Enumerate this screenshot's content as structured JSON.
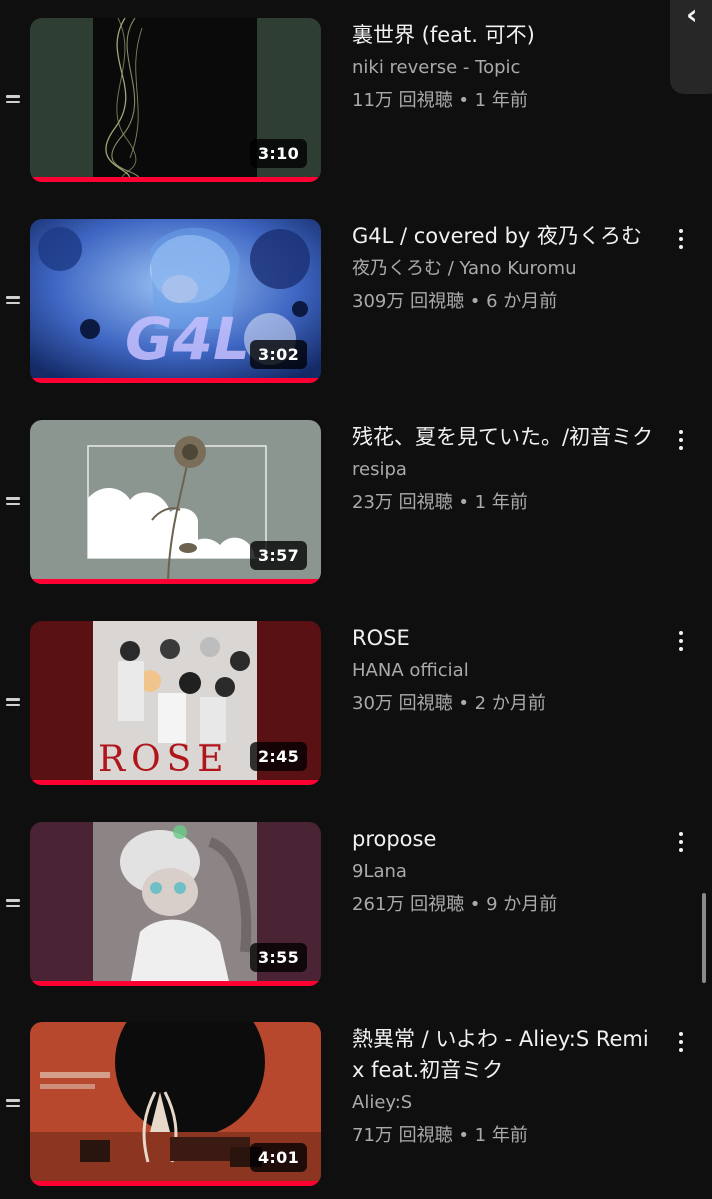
{
  "colors": {
    "background": "#0f0f0f",
    "progress": "#ff0033",
    "secondary_text": "#aaaaaa"
  },
  "playlist": {
    "items": [
      {
        "title": "裏世界 (feat. 可不)",
        "channel": "niki reverse - Topic",
        "meta": "11万 回視聴 • 1 年前",
        "duration": "3:10",
        "watched": 1.0,
        "thumb_colors": {
          "bg": "#2f3e33",
          "art": "#0a0a0a",
          "accent": "#b8c48a"
        },
        "has_menu": false
      },
      {
        "title": "G4L / covered by 夜乃くろむ",
        "channel": "夜乃くろむ / Yano Kuromu",
        "meta": "309万 回視聴 • 6 か月前",
        "duration": "3:02",
        "watched": 1.0,
        "thumb_colors": {
          "bg": "#2b4f9c",
          "art": "#8fb5ef",
          "accent": "#c6c0ff"
        },
        "has_menu": true
      },
      {
        "title": "残花、夏を見ていた。/初音ミク",
        "channel": "resipa",
        "meta": "23万 回視聴 • 1 年前",
        "duration": "3:57",
        "watched": 1.0,
        "thumb_colors": {
          "bg": "#8b9691",
          "art": "#ffffff",
          "accent": "#7a6e58"
        },
        "has_menu": true
      },
      {
        "title": "ROSE",
        "channel": "HANA official",
        "meta": "30万 回視聴 • 2 か月前",
        "duration": "2:45",
        "watched": 1.0,
        "thumb_colors": {
          "bg": "#5a1114",
          "art": "#d9d6d3",
          "accent": "#b0151c"
        },
        "has_menu": true
      },
      {
        "title": "propose",
        "channel": "9Lana",
        "meta": "261万 回視聴 • 9 か月前",
        "duration": "3:55",
        "watched": 1.0,
        "thumb_colors": {
          "bg": "#4a2335",
          "art": "#8d8486",
          "accent": "#cfcfcf"
        },
        "has_menu": true
      },
      {
        "title": "熱異常 / いよわ - Aliey:S Remix feat.初音ミク",
        "channel": "Aliey:S",
        "meta": "71万 回視聴 • 1 年前",
        "duration": "4:01",
        "watched": 1.0,
        "thumb_colors": {
          "bg": "#b7482d",
          "art": "#0c0c0c",
          "accent": "#e7d8c9"
        },
        "has_menu": true
      }
    ]
  }
}
